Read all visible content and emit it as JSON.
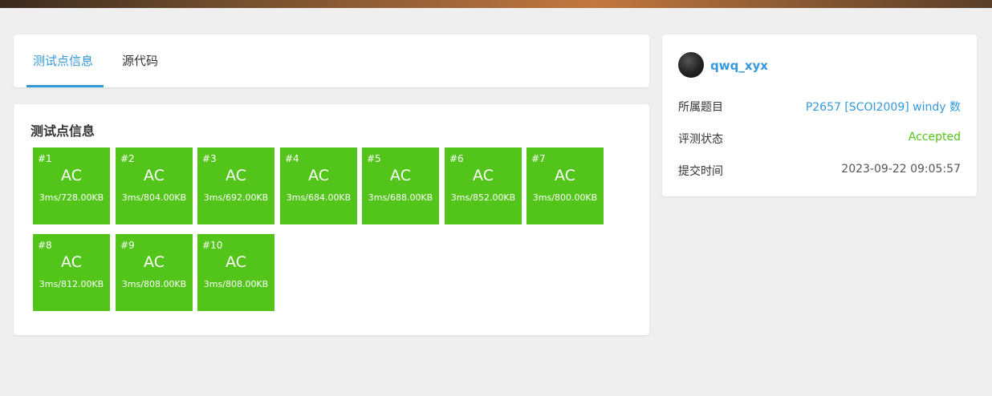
{
  "tabs": [
    {
      "label": "测试点信息",
      "active": true
    },
    {
      "label": "源代码",
      "active": false
    }
  ],
  "tests": {
    "title": "测试点信息",
    "color": "#52c41a",
    "cases": [
      {
        "num": "#1",
        "status": "AC",
        "info": "3ms/728.00KB"
      },
      {
        "num": "#2",
        "status": "AC",
        "info": "3ms/804.00KB"
      },
      {
        "num": "#3",
        "status": "AC",
        "info": "3ms/692.00KB"
      },
      {
        "num": "#4",
        "status": "AC",
        "info": "3ms/684.00KB"
      },
      {
        "num": "#5",
        "status": "AC",
        "info": "3ms/688.00KB"
      },
      {
        "num": "#6",
        "status": "AC",
        "info": "3ms/852.00KB"
      },
      {
        "num": "#7",
        "status": "AC",
        "info": "3ms/800.00KB"
      },
      {
        "num": "#8",
        "status": "AC",
        "info": "3ms/812.00KB"
      },
      {
        "num": "#9",
        "status": "AC",
        "info": "3ms/808.00KB"
      },
      {
        "num": "#10",
        "status": "AC",
        "info": "3ms/808.00KB"
      }
    ]
  },
  "sidebar": {
    "username": "qwq_xyx",
    "problem_label": "所属题目",
    "problem_value": "P2657 [SCOI2009] windy 数",
    "status_label": "评测状态",
    "status_value": "Accepted",
    "time_label": "提交时间",
    "time_value": "2023-09-22 09:05:57"
  },
  "colors": {
    "accent": "#3498db",
    "accepted": "#52c41a",
    "background": "#efefef"
  }
}
